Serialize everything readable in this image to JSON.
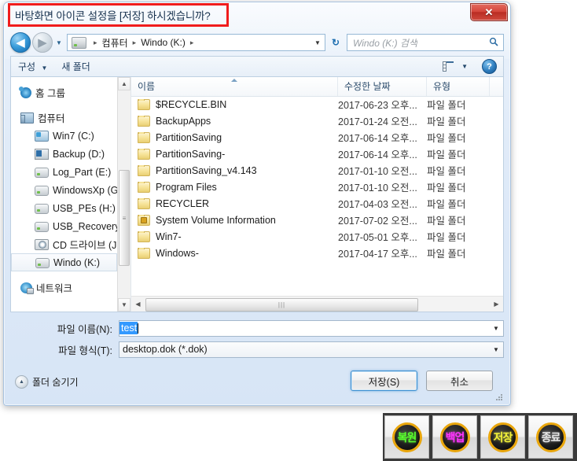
{
  "window": {
    "title": "바탕화면 아이콘 설정을 [저장] 하시겠습니까?",
    "close_label": "✕"
  },
  "addressbar": {
    "back_icon": "◀",
    "forward_icon": "▶",
    "history_caret": "▼",
    "crumbs": [
      "컴퓨터",
      "Windo (K:)"
    ],
    "crumb_sep": "▸",
    "dropdown_caret": "▼",
    "refresh_icon": "↻",
    "search_placeholder": "Windo (K:) 검색",
    "search_icon": "🔍"
  },
  "toolbar": {
    "organize_label": "구성",
    "organize_caret": "▼",
    "new_folder_label": "새 폴더",
    "view_caret": "▼",
    "help_label": "?"
  },
  "navpane": {
    "items": [
      {
        "label": "홈 그룹",
        "icon": "homegroup-icon",
        "level": "root",
        "icon_class": "ic-home",
        "selected": false
      },
      {
        "label": "컴퓨터",
        "icon": "computer-icon",
        "level": "root",
        "icon_class": "ic-pc",
        "selected": false
      },
      {
        "label": "Win7 (C:)",
        "icon": "drive-windows-icon",
        "level": "child",
        "icon_class": "ic-win",
        "selected": false
      },
      {
        "label": "Backup (D:)",
        "icon": "drive-backup-icon",
        "level": "child",
        "icon_class": "ic-bak",
        "selected": false
      },
      {
        "label": "Log_Part (E:)",
        "icon": "drive-icon",
        "level": "child",
        "icon_class": "ic-drive",
        "selected": false
      },
      {
        "label": "WindowsXp (G:)",
        "icon": "drive-icon",
        "level": "child",
        "icon_class": "ic-drive",
        "selected": false
      },
      {
        "label": "USB_PEs (H:)",
        "icon": "drive-icon",
        "level": "child",
        "icon_class": "ic-drive",
        "selected": false
      },
      {
        "label": "USB_Recovery (I:",
        "icon": "drive-icon",
        "level": "child",
        "icon_class": "ic-drive",
        "selected": false
      },
      {
        "label": "CD 드라이브 (J:)",
        "icon": "cd-drive-icon",
        "level": "child",
        "icon_class": "ic-cd",
        "selected": false
      },
      {
        "label": "Windo (K:)",
        "icon": "drive-icon",
        "level": "child",
        "icon_class": "ic-drive",
        "selected": true
      },
      {
        "label": "네트워크",
        "icon": "network-icon",
        "level": "root",
        "icon_class": "ic-net",
        "selected": false
      }
    ],
    "scroll_up_caret": "▲",
    "scroll_down_caret": "▼",
    "thumb_grip": "≡"
  },
  "filelist": {
    "columns": [
      "이름",
      "수정한 날짜",
      "유형"
    ],
    "rows": [
      {
        "name": "$RECYCLE.BIN",
        "date": "2017-06-23 오후...",
        "type": "파일 폴더",
        "locked": false
      },
      {
        "name": "BackupApps",
        "date": "2017-01-24 오전...",
        "type": "파일 폴더",
        "locked": false
      },
      {
        "name": "PartitionSaving",
        "date": "2017-06-14 오후...",
        "type": "파일 폴더",
        "locked": false
      },
      {
        "name": "PartitionSaving-",
        "date": "2017-06-14 오후...",
        "type": "파일 폴더",
        "locked": false
      },
      {
        "name": "PartitionSaving_v4.143",
        "date": "2017-01-10 오전...",
        "type": "파일 폴더",
        "locked": false
      },
      {
        "name": "Program Files",
        "date": "2017-01-10 오전...",
        "type": "파일 폴더",
        "locked": false
      },
      {
        "name": "RECYCLER",
        "date": "2017-04-03 오전...",
        "type": "파일 폴더",
        "locked": false
      },
      {
        "name": "System Volume Information",
        "date": "2017-07-02 오전...",
        "type": "파일 폴더",
        "locked": true
      },
      {
        "name": "Win7-",
        "date": "2017-05-01 오후...",
        "type": "파일 폴더",
        "locked": false
      },
      {
        "name": "Windows-",
        "date": "2017-04-17 오후...",
        "type": "파일 폴더",
        "locked": false
      }
    ],
    "hscroll_left": "◀",
    "hscroll_right": "▶",
    "hscroll_grip": "|||"
  },
  "form": {
    "filename_label": "파일 이름(N):",
    "filename_value": "test",
    "filetype_label": "파일 형식(T):",
    "filetype_value": "desktop.dok (*.dok)",
    "dropdown_caret": "▼"
  },
  "footer": {
    "hide_folders_label": "폴더 숨기기",
    "hide_folders_caret": "▲",
    "save_label": "저장(S)",
    "cancel_label": "취소"
  },
  "circlebar": {
    "buttons": [
      {
        "label": "복원",
        "color": "#5aff2e"
      },
      {
        "label": "백업",
        "color": "#ff35ff"
      },
      {
        "label": "저장",
        "color": "#f2f23a"
      },
      {
        "label": "종료",
        "color": "#e7e7e7"
      }
    ]
  }
}
